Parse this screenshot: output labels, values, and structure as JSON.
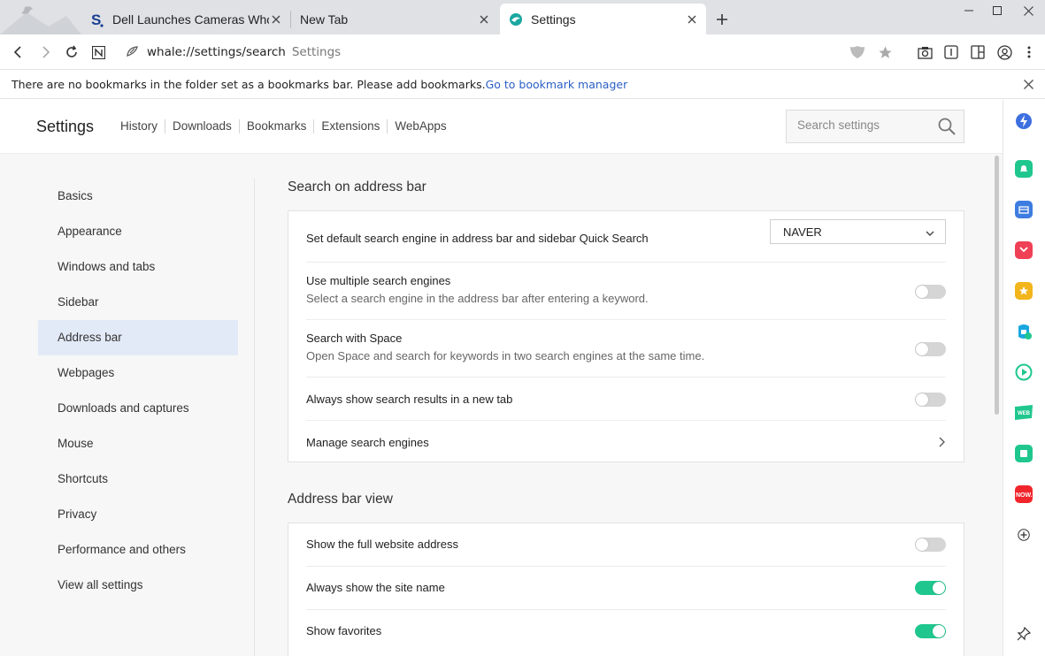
{
  "tabs": [
    {
      "title": "Dell Launches Cameras Whose",
      "favicon": "softpedia-s-icon"
    },
    {
      "title": "New Tab",
      "favicon": ""
    },
    {
      "title": "Settings",
      "favicon": "whale-icon"
    }
  ],
  "address": {
    "url": "whale://settings/search",
    "page_title": "Settings"
  },
  "bookmark_bar": {
    "message": "There are no bookmarks in the folder set as a bookmarks bar. Please add bookmarks.",
    "link": "Go to bookmark manager"
  },
  "header": {
    "title": "Settings",
    "links": [
      "History",
      "Downloads",
      "Bookmarks",
      "Extensions",
      "WebApps"
    ],
    "search_placeholder": "Search settings"
  },
  "sidebar_nav": {
    "items": [
      {
        "label": "Basics",
        "active": false
      },
      {
        "label": "Appearance",
        "active": false
      },
      {
        "label": "Windows and tabs",
        "active": false
      },
      {
        "label": "Sidebar",
        "active": false
      },
      {
        "label": "Address bar",
        "active": true
      },
      {
        "label": "Webpages",
        "active": false
      },
      {
        "label": "Downloads and captures",
        "active": false
      },
      {
        "label": "Mouse",
        "active": false
      },
      {
        "label": "Shortcuts",
        "active": false
      },
      {
        "label": "Privacy",
        "active": false
      },
      {
        "label": "Performance and others",
        "active": false
      },
      {
        "label": "View all settings",
        "active": false
      }
    ]
  },
  "search_section": {
    "title": "Search on address bar",
    "default_engine": {
      "label": "Set default search engine in address bar and sidebar Quick Search",
      "value": "NAVER"
    },
    "multiple_engines": {
      "label": "Use multiple search engines",
      "desc": "Select a search engine in the address bar after entering a keyword.",
      "on": false
    },
    "search_with_space": {
      "label": "Search with Space",
      "desc": "Open Space and search for keywords in two search engines at the same time.",
      "on": false
    },
    "new_tab": {
      "label": "Always show search results in a new tab",
      "on": false
    },
    "manage": {
      "label": "Manage search engines"
    }
  },
  "view_section": {
    "title": "Address bar view",
    "full_address": {
      "label": "Show the full website address",
      "on": false
    },
    "site_name": {
      "label": "Always show the site name",
      "on": true
    },
    "favorites": {
      "label": "Show favorites",
      "on": true
    }
  },
  "colors": {
    "accent_toggle": "#1fc78f",
    "link": "#2b5fc4",
    "active_nav": "#e3eaf7"
  }
}
